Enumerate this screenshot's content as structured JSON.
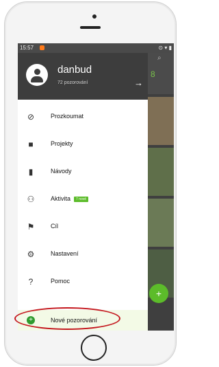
{
  "status_bar": {
    "time": "15:57",
    "right_icons": "⊙ ▾ ▮"
  },
  "drawer": {
    "username": "danbud",
    "observations": "72 pozorování",
    "items": [
      {
        "label": "Prozkoumat",
        "icon": "compass-icon"
      },
      {
        "label": "Projekty",
        "icon": "briefcase-icon"
      },
      {
        "label": "Návody",
        "icon": "book-icon"
      },
      {
        "label": "Aktivita",
        "icon": "people-icon",
        "badge": "7 nové"
      },
      {
        "label": "Cíl",
        "icon": "flag-icon"
      },
      {
        "label": "Nastavení",
        "icon": "gear-icon"
      },
      {
        "label": "Pomoc",
        "icon": "help-icon"
      }
    ],
    "new_observation": "Nové pozorování"
  },
  "background": {
    "count": "8"
  },
  "colors": {
    "accent": "#5cbc2a",
    "highlight": "#c4171d"
  }
}
